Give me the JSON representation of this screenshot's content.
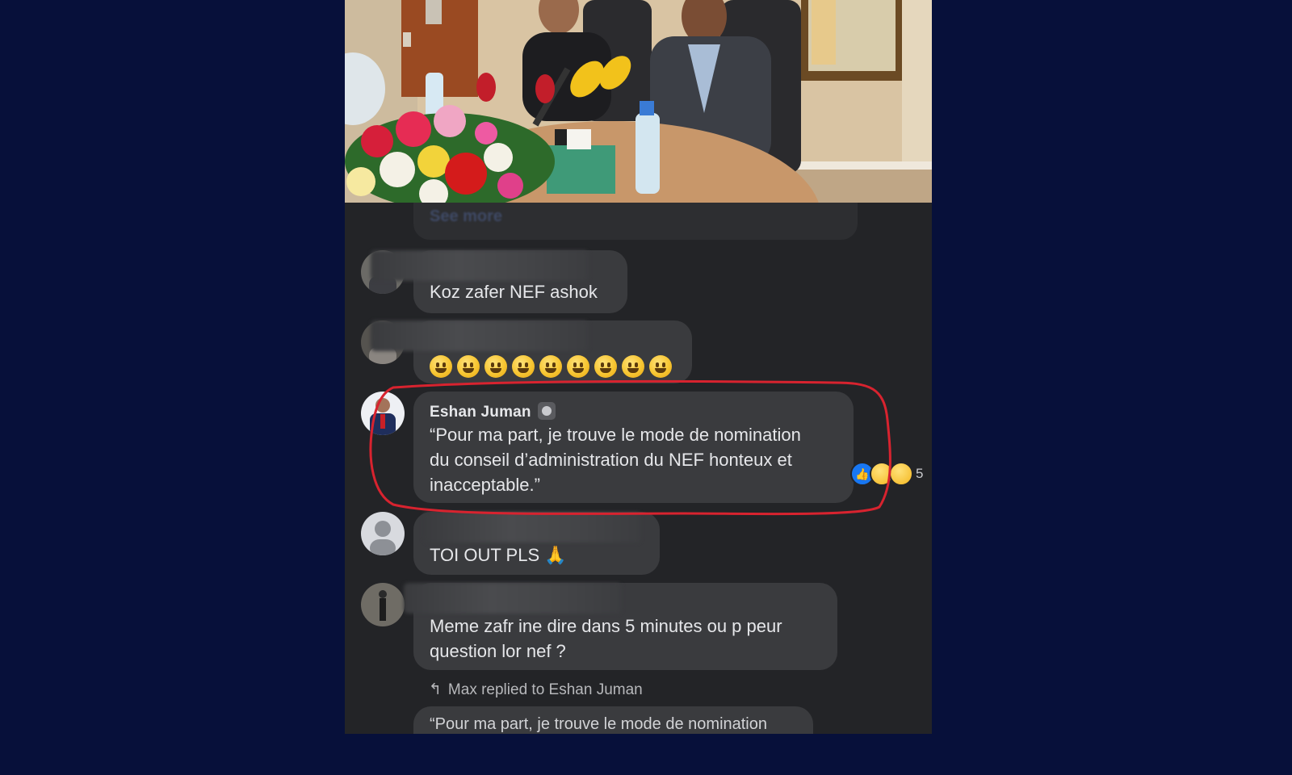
{
  "post": {
    "see_more_label": "See more"
  },
  "comments": [
    {
      "text": "Koz zafer NEF ashok"
    },
    {
      "emoji_name": "grinning-face",
      "emoji_count": 9
    },
    {
      "author": "Eshan Juman",
      "text_lines": [
        "“Pour ma part, je trouve le mode de nomination",
        "du conseil d’administration du NEF honteux et",
        "inacceptable.”"
      ],
      "reactions": [
        "like",
        "haha",
        "wow"
      ],
      "reaction_count": "5",
      "highlight_color": "#d8232f"
    },
    {
      "text": "TOI OUT PLS 🙏"
    },
    {
      "text_lines": [
        "Meme zafr ine dire dans 5 minutes ou p peur",
        "question lor nef ?"
      ]
    }
  ],
  "reply_notice": "Max replied to Eshan Juman",
  "reply_preview": "“Pour ma part, je trouve le mode de nomination",
  "colors": {
    "page_bg": "#07103a",
    "panel_bg": "#232427",
    "bubble_bg": "#3a3b3e",
    "like_blue": "#1877f2"
  }
}
